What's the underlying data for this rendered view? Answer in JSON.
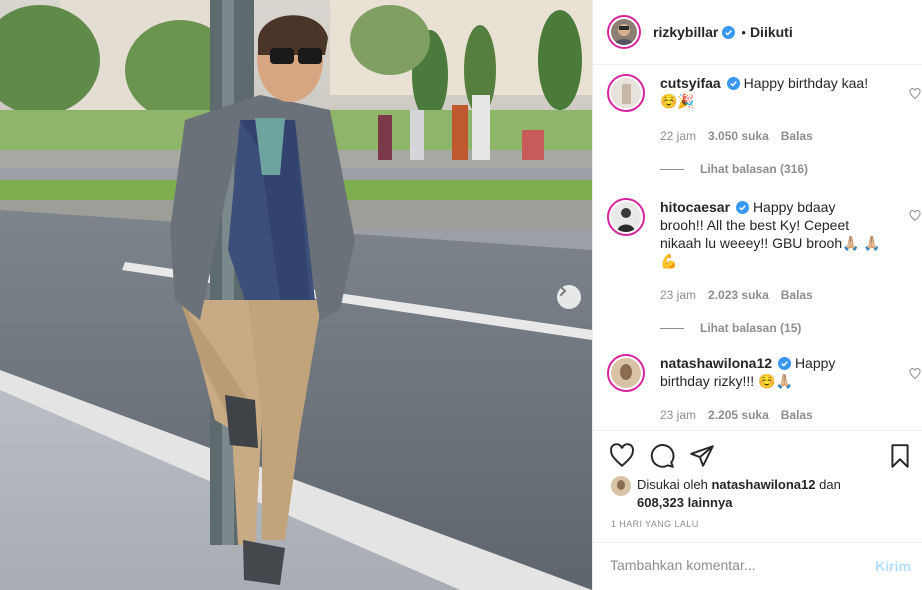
{
  "post": {
    "author": "rizkybillar",
    "follow_status": "Diikuti",
    "dot": "•"
  },
  "comments": [
    {
      "username": "cutsyifaa",
      "text": "Happy birthday kaa! ☺️🎉",
      "time": "22 jam",
      "likes": "3.050 suka",
      "reply_label": "Balas",
      "view_replies": "Lihat balasan (316)"
    },
    {
      "username": "hitocaesar",
      "text": "Happy bdaay brooh!! All the best Ky! Cepeet nikaah lu weeey!! GBU brooh🙏🏼 🙏🏼💪",
      "time": "23 jam",
      "likes": "2.023 suka",
      "reply_label": "Balas",
      "view_replies": "Lihat balasan (15)"
    },
    {
      "username": "natashawilona12",
      "text": "Happy birthday rizky!!! ☺️🙏🏼",
      "time": "23 jam",
      "likes": "2.205 suka",
      "reply_label": "Balas"
    }
  ],
  "likes_summary": {
    "prefix": "Disukai oleh",
    "user": "natashawilona12",
    "middle": "dan",
    "count": "608,323",
    "suffix": "lainnya"
  },
  "post_date": "1 HARI YANG LALU",
  "add_comment": {
    "placeholder": "Tambahkan komentar...",
    "post_label": "Kirim"
  },
  "icons": {
    "verified": "verified-badge-icon",
    "heart": "heart-icon",
    "comment": "comment-icon",
    "share": "paper-plane-icon",
    "save": "bookmark-icon",
    "next": "chevron-right-icon"
  },
  "colors": {
    "verified_blue": "#3897f0",
    "story_ring": "#d6249f",
    "post_button": "#b2dffc",
    "muted": "#8e8e8e"
  }
}
